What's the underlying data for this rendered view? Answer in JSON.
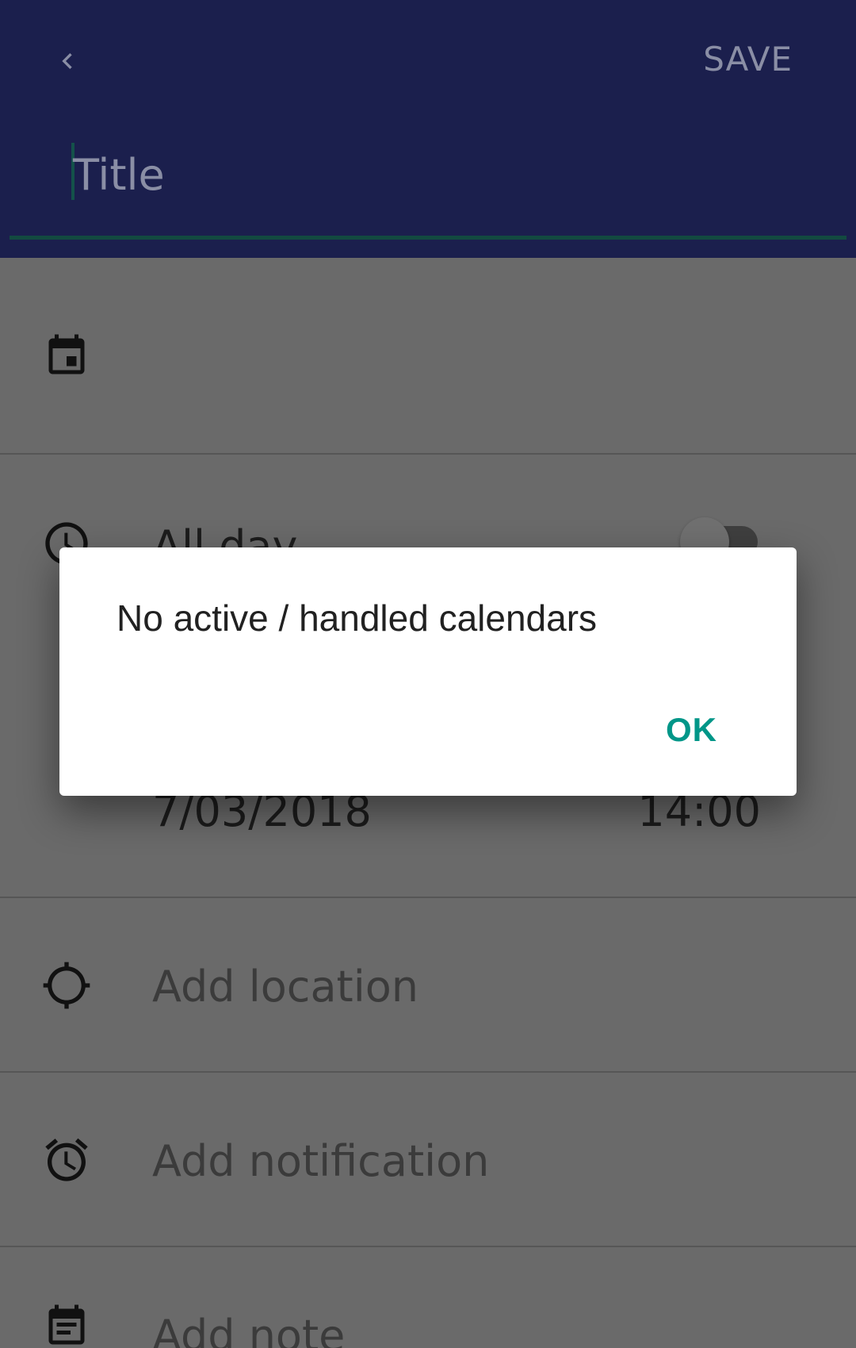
{
  "appbar": {
    "back_icon": "chevron-left-icon",
    "save_label": "SAVE",
    "title_placeholder": "Title"
  },
  "rows": {
    "calendar": {
      "icon": "calendar-icon"
    },
    "all_day": {
      "icon": "clock-icon",
      "label": "All day",
      "toggle_on": false
    },
    "end": {
      "date": "7/03/2018",
      "time": "14:00"
    },
    "location": {
      "icon": "crosshair-icon",
      "placeholder": "Add location"
    },
    "notification": {
      "icon": "alarm-icon",
      "placeholder": "Add notification"
    },
    "note": {
      "icon": "note-icon",
      "placeholder": "Add note"
    }
  },
  "dialog": {
    "message": "No active / handled calendars",
    "ok_label": "OK"
  },
  "colors": {
    "appbar": "#1a237e",
    "accent": "#009688",
    "scrim": "rgba(0,0,0,0.6)"
  }
}
